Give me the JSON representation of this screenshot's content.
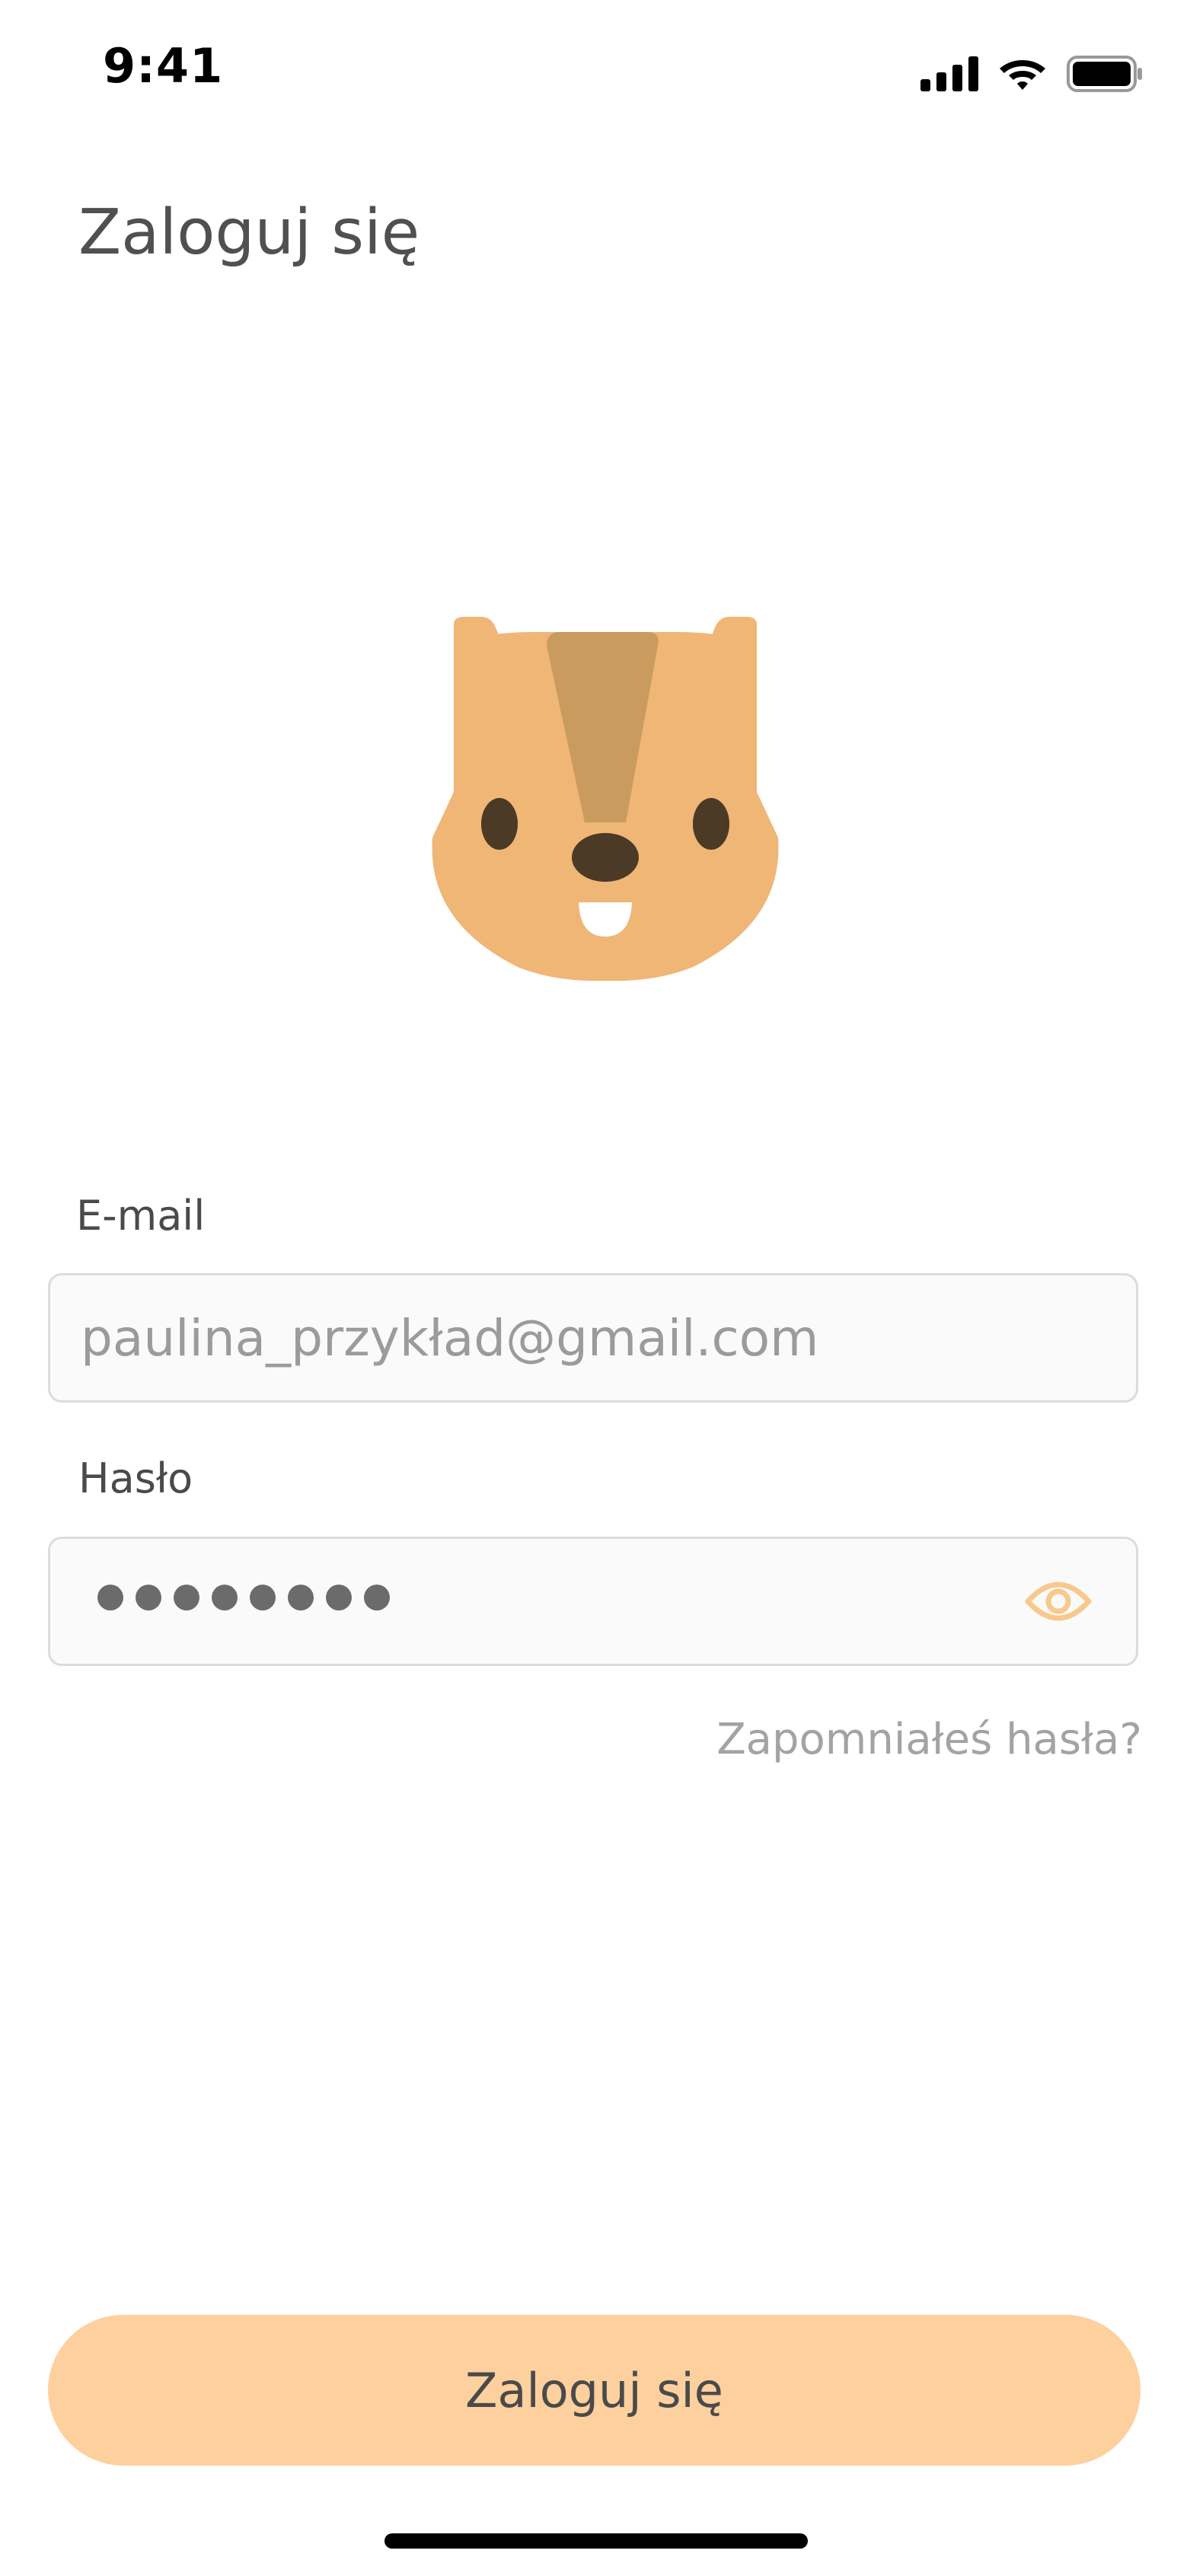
{
  "status_bar": {
    "time": "9:41",
    "icons": [
      "signal-icon",
      "wifi-icon",
      "battery-icon"
    ]
  },
  "page": {
    "title": "Zaloguj się"
  },
  "mascot": {
    "icon": "chipmunk-mascot",
    "colors": {
      "fur": "#f0b676",
      "stripe": "#c99b5e",
      "eyes": "#4a3a26",
      "tooth": "#ffffff"
    }
  },
  "form": {
    "email": {
      "label": "E-mail",
      "placeholder": "paulina_przykład@gmail.com",
      "value": ""
    },
    "password": {
      "label": "Hasło",
      "masked_length": 8,
      "toggle_icon": "eye-icon"
    },
    "forgot_password": "Zapomniałeś hasła?"
  },
  "actions": {
    "login_label": "Zaloguj się"
  },
  "colors": {
    "accent": "#fdd09e",
    "eye_icon": "#f9c88d",
    "text": "#4a4a4a",
    "muted_text": "#a3a3a3",
    "input_border": "#dcdcdc"
  }
}
